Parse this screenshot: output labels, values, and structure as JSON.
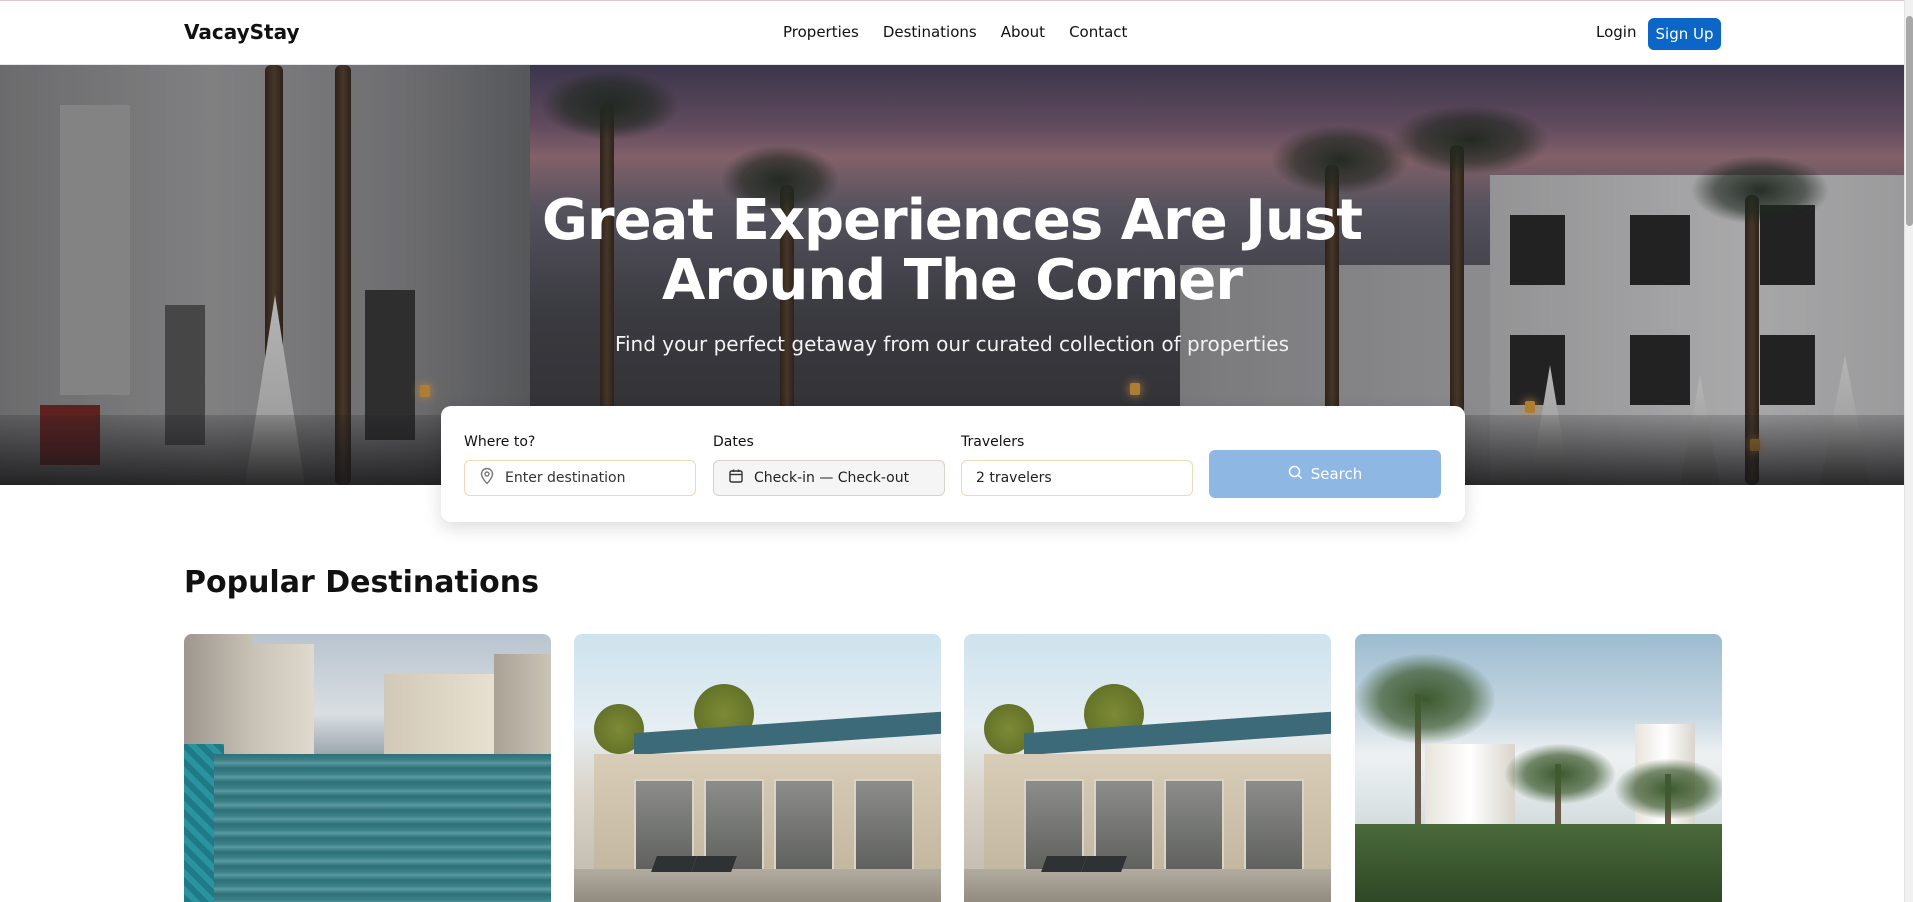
{
  "brand": "VacayStay",
  "nav": {
    "links": [
      "Properties",
      "Destinations",
      "About",
      "Contact"
    ],
    "login": "Login",
    "signup": "Sign Up"
  },
  "hero": {
    "title_line1": "Great Experiences Are Just",
    "title_line2": "Around The Corner",
    "subtitle": "Find your perfect getaway from our curated collection of properties"
  },
  "search": {
    "where_label": "Where to?",
    "where_placeholder": "Enter destination",
    "dates_label": "Dates",
    "dates_value": "Check-in — Check-out",
    "travelers_label": "Travelers",
    "travelers_value": "2 travelers",
    "button_label": "Search",
    "button_color": "#8fb7e4"
  },
  "destinations": {
    "title": "Popular Destinations"
  },
  "colors": {
    "accent": "#0b66c8"
  },
  "icons": {
    "location": "map-pin-icon",
    "calendar": "calendar-icon",
    "search": "search-icon"
  }
}
